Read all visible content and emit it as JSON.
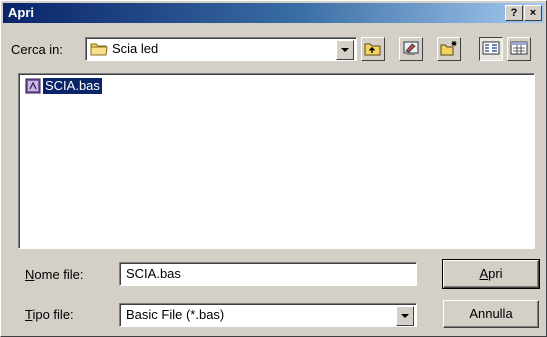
{
  "window": {
    "title": "Apri",
    "help_label": "?",
    "close_label": "×"
  },
  "look_in": {
    "label": "Cerca in:",
    "value": "Scia led"
  },
  "toolbar": {
    "icons": [
      "folder-up-icon",
      "desktop-icon",
      "new-folder-icon",
      "list-view-icon",
      "details-view-icon"
    ]
  },
  "file_list": {
    "items": [
      {
        "name": "SCIA.bas",
        "selected": true,
        "icon": "basic-file-icon"
      }
    ]
  },
  "filename": {
    "label_accel": "N",
    "label_rest": "ome file:",
    "value": "SCIA.bas"
  },
  "filetype": {
    "label_accel": "T",
    "label_rest": "ipo file:",
    "value": "Basic File (*.bas)"
  },
  "buttons": {
    "open_accel": "A",
    "open_rest": "pri",
    "cancel": "Annulla"
  },
  "colors": {
    "titlebar_start": "#0a246a",
    "titlebar_end": "#a6caf0",
    "selection": "#0a246a",
    "face": "#d4d0c8"
  }
}
